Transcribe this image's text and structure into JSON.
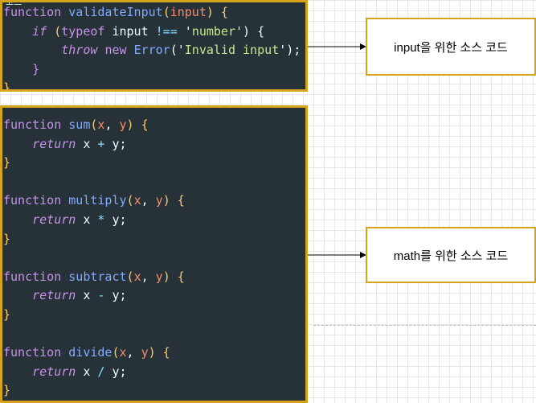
{
  "top_note": "코드",
  "panel1_lines": [
    [
      {
        "t": "function ",
        "c": "kw"
      },
      {
        "t": "validateInput",
        "c": "fn"
      },
      {
        "t": "(",
        "c": "brace"
      },
      {
        "t": "input",
        "c": "param"
      },
      {
        "t": ") {",
        "c": "brace"
      }
    ],
    [
      {
        "t": "    ",
        "c": "white"
      },
      {
        "t": "if",
        "c": "ctl"
      },
      {
        "t": " (",
        "c": "brace"
      },
      {
        "t": "typeof",
        "c": "kw"
      },
      {
        "t": " input ",
        "c": "white"
      },
      {
        "t": "!==",
        "c": "op"
      },
      {
        "t": " '",
        "c": "white"
      },
      {
        "t": "number",
        "c": "str"
      },
      {
        "t": "') {",
        "c": "white"
      }
    ],
    [
      {
        "t": "        ",
        "c": "white"
      },
      {
        "t": "throw",
        "c": "ctl"
      },
      {
        "t": " ",
        "c": "white"
      },
      {
        "t": "new",
        "c": "kw"
      },
      {
        "t": " ",
        "c": "white"
      },
      {
        "t": "Error",
        "c": "fn"
      },
      {
        "t": "('",
        "c": "white"
      },
      {
        "t": "Invalid input",
        "c": "str"
      },
      {
        "t": "');",
        "c": "white"
      }
    ],
    [
      {
        "t": "    }",
        "c": "kw"
      }
    ],
    [
      {
        "t": "}",
        "c": "brace"
      }
    ]
  ],
  "panel2_lines": [
    [
      {
        "t": "function ",
        "c": "kw"
      },
      {
        "t": "sum",
        "c": "fn"
      },
      {
        "t": "(",
        "c": "brace"
      },
      {
        "t": "x",
        "c": "param"
      },
      {
        "t": ", ",
        "c": "white"
      },
      {
        "t": "y",
        "c": "param"
      },
      {
        "t": ") {",
        "c": "brace"
      }
    ],
    [
      {
        "t": "    ",
        "c": "white"
      },
      {
        "t": "return",
        "c": "ctl"
      },
      {
        "t": " x ",
        "c": "white"
      },
      {
        "t": "+",
        "c": "op"
      },
      {
        "t": " y;",
        "c": "white"
      }
    ],
    [
      {
        "t": "}",
        "c": "brace"
      }
    ],
    [
      {
        "t": "",
        "c": "white"
      }
    ],
    [
      {
        "t": "function ",
        "c": "kw"
      },
      {
        "t": "multiply",
        "c": "fn"
      },
      {
        "t": "(",
        "c": "brace"
      },
      {
        "t": "x",
        "c": "param"
      },
      {
        "t": ", ",
        "c": "white"
      },
      {
        "t": "y",
        "c": "param"
      },
      {
        "t": ") {",
        "c": "brace"
      }
    ],
    [
      {
        "t": "    ",
        "c": "white"
      },
      {
        "t": "return",
        "c": "ctl"
      },
      {
        "t": " x ",
        "c": "white"
      },
      {
        "t": "*",
        "c": "op"
      },
      {
        "t": " y;",
        "c": "white"
      }
    ],
    [
      {
        "t": "}",
        "c": "brace"
      }
    ],
    [
      {
        "t": "",
        "c": "white"
      }
    ],
    [
      {
        "t": "function ",
        "c": "kw"
      },
      {
        "t": "subtract",
        "c": "fn"
      },
      {
        "t": "(",
        "c": "brace"
      },
      {
        "t": "x",
        "c": "param"
      },
      {
        "t": ", ",
        "c": "white"
      },
      {
        "t": "y",
        "c": "param"
      },
      {
        "t": ") {",
        "c": "brace"
      }
    ],
    [
      {
        "t": "    ",
        "c": "white"
      },
      {
        "t": "return",
        "c": "ctl"
      },
      {
        "t": " x ",
        "c": "white"
      },
      {
        "t": "-",
        "c": "op"
      },
      {
        "t": " y;",
        "c": "white"
      }
    ],
    [
      {
        "t": "}",
        "c": "brace"
      }
    ],
    [
      {
        "t": "",
        "c": "white"
      }
    ],
    [
      {
        "t": "function ",
        "c": "kw"
      },
      {
        "t": "divide",
        "c": "fn"
      },
      {
        "t": "(",
        "c": "brace"
      },
      {
        "t": "x",
        "c": "param"
      },
      {
        "t": ", ",
        "c": "white"
      },
      {
        "t": "y",
        "c": "param"
      },
      {
        "t": ") {",
        "c": "brace"
      }
    ],
    [
      {
        "t": "    ",
        "c": "white"
      },
      {
        "t": "return",
        "c": "ctl"
      },
      {
        "t": " x ",
        "c": "white"
      },
      {
        "t": "/",
        "c": "op"
      },
      {
        "t": " y;",
        "c": "white"
      }
    ],
    [
      {
        "t": "}",
        "c": "brace"
      }
    ]
  ],
  "callouts": {
    "input": "input을 위한 소스 코드",
    "math": "math를 위한 소스 코드"
  },
  "colors": {
    "border": "#d6a418",
    "panel_bg": "#263238"
  }
}
